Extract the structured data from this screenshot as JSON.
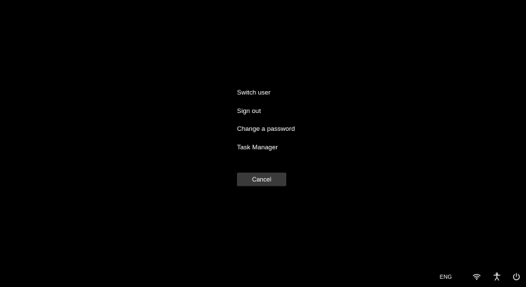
{
  "menu": {
    "items": [
      {
        "label": "Switch user"
      },
      {
        "label": "Sign out"
      },
      {
        "label": "Change a password"
      },
      {
        "label": "Task Manager"
      }
    ]
  },
  "cancel": {
    "label": "Cancel"
  },
  "tray": {
    "language": "ENG",
    "icons": [
      "wifi-icon",
      "accessibility-icon",
      "power-icon"
    ]
  },
  "colors": {
    "background": "#000000",
    "text": "#ffffff",
    "button": "#3a3a3a"
  }
}
